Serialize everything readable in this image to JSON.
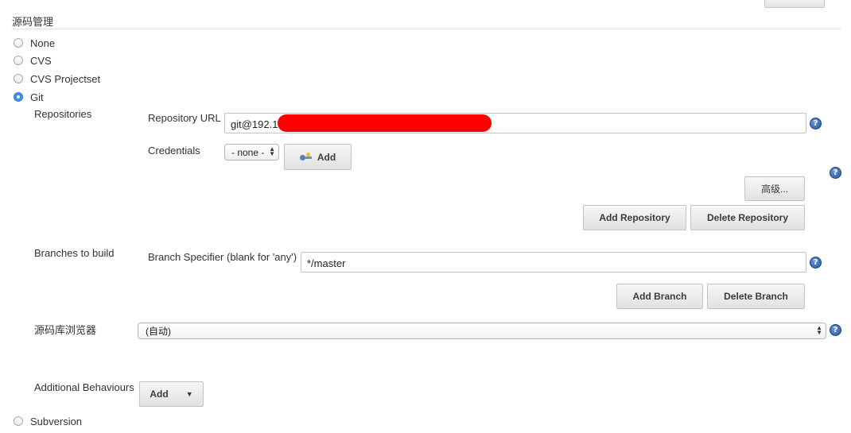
{
  "section": {
    "title": "源码管理"
  },
  "scm_options": [
    {
      "label": "None",
      "checked": false
    },
    {
      "label": "CVS",
      "checked": false
    },
    {
      "label": "CVS Projectset",
      "checked": false
    },
    {
      "label": "Git",
      "checked": true
    },
    {
      "label": "Subversion",
      "checked": false
    }
  ],
  "git": {
    "repositories_label": "Repositories",
    "repository_url_label": "Repository URL",
    "repository_url_value": "git@192.1",
    "credentials_label": "Credentials",
    "credentials_selected": "- none -",
    "credentials_add_label": "Add",
    "advanced_label": "高级...",
    "add_repository_label": "Add Repository",
    "delete_repository_label": "Delete Repository",
    "branches_label": "Branches to build",
    "branch_specifier_label": "Branch Specifier (blank for 'any')",
    "branch_specifier_value": "*/master",
    "add_branch_label": "Add Branch",
    "delete_branch_label": "Delete Branch",
    "browser_label": "源码库浏览器",
    "browser_selected": "(自动)",
    "additional_behaviours_label": "Additional Behaviours",
    "additional_add_label": "Add"
  },
  "help_glyph": "?",
  "icons": [
    "help-icon",
    "key-icon",
    "dropdown-caret-icon",
    "select-arrows-icon"
  ],
  "colors": {
    "accent": "#3b8ef0",
    "help": "#22539a",
    "redaction": "#ff0000"
  }
}
